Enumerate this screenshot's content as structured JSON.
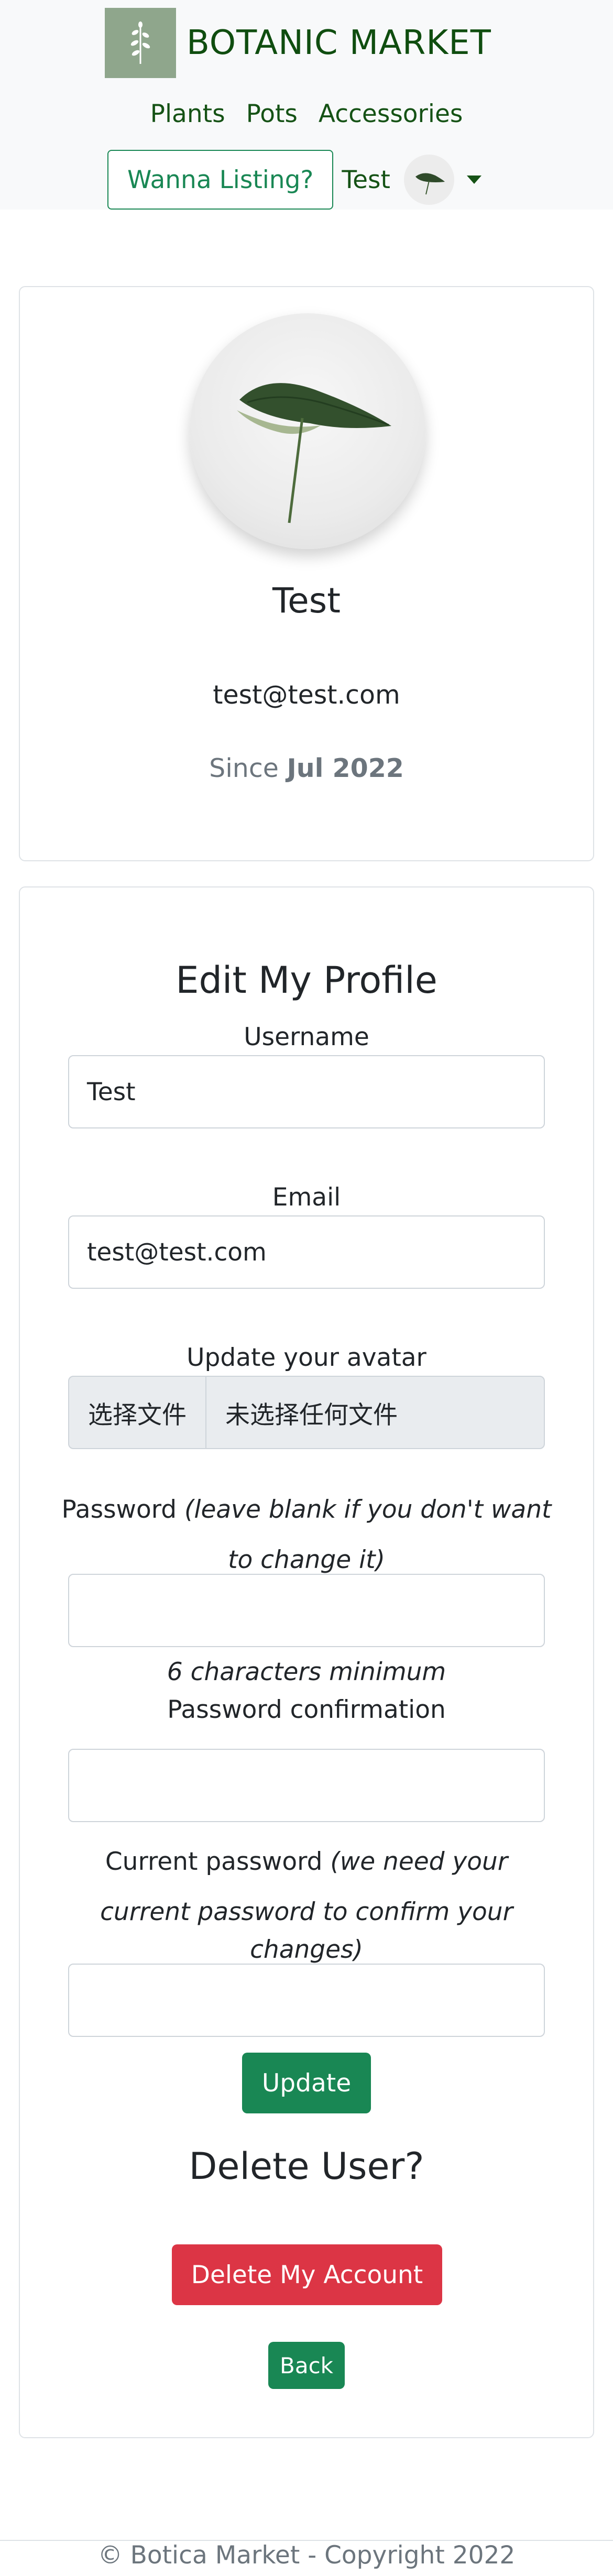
{
  "header": {
    "brand": "BOTANIC MARKET",
    "nav": [
      "Plants",
      "Pots",
      "Accessories"
    ],
    "listing_button": "Wanna Listing?",
    "username": "Test"
  },
  "profile": {
    "name": "Test",
    "email": "test@test.com",
    "since_prefix": "Since",
    "since_date": "Jul 2022"
  },
  "form": {
    "title": "Edit My Profile",
    "username_label": "Username",
    "username_value": "Test",
    "email_label": "Email",
    "email_value": "test@test.com",
    "avatar_label": "Update your avatar",
    "file_button": "选择文件",
    "file_status": "未选择任何文件",
    "password_label": "Password",
    "password_hint_line1": "(leave blank if you don't want",
    "password_hint_line2": "to change it)",
    "password_min": "6 characters minimum",
    "confirm_label": "Password confirmation",
    "current_label": "Current password",
    "current_hint_line1": "(we need your",
    "current_hint_line2": "current password to confirm your",
    "current_hint_line3": "changes)",
    "update_button": "Update"
  },
  "delete": {
    "title": "Delete User?",
    "button": "Delete My Account",
    "back_button": "Back"
  },
  "footer": {
    "text": "© Botica Market - Copyright 2022"
  },
  "colors": {
    "green": "#198754",
    "red": "#dc3545",
    "brand_text": "#0f4d0f"
  }
}
